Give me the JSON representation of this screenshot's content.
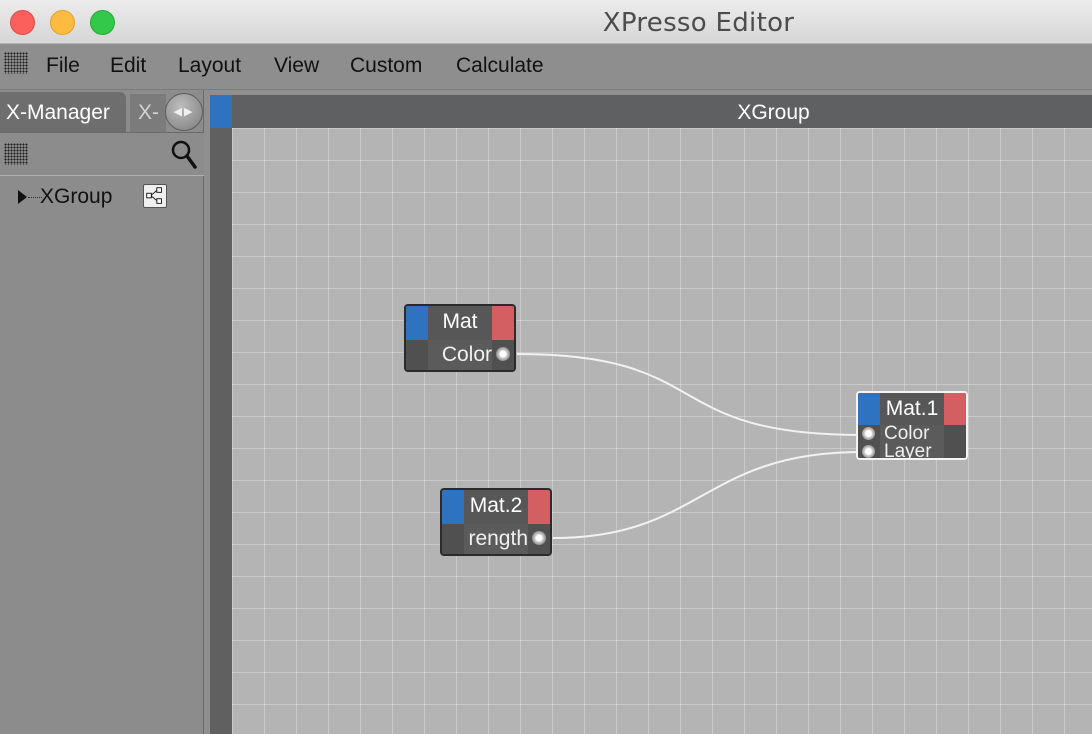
{
  "window": {
    "title": "XPresso Editor",
    "traffic_lights": [
      "close",
      "minimize",
      "zoom"
    ]
  },
  "menu": {
    "items": [
      "File",
      "Edit",
      "Layout",
      "View",
      "Custom",
      "Calculate"
    ]
  },
  "left_panel": {
    "active_tab": "X-Manager",
    "inactive_tab": "X-",
    "tree": [
      {
        "label": "XGroup",
        "icon": "xgroup-node-icon"
      }
    ]
  },
  "editor": {
    "title": "XGroup",
    "nodes": [
      {
        "id": "mat",
        "title": "Mat",
        "ports": [
          "Color"
        ]
      },
      {
        "id": "mat2",
        "title": "Mat.2",
        "ports": [
          "rength"
        ]
      },
      {
        "id": "mat1",
        "title": "Mat.1",
        "ports": [
          "Color",
          "Layer"
        ]
      }
    ],
    "connections": [
      {
        "from": "Mat.Color",
        "to": "Mat.1.Color"
      },
      {
        "from": "Mat.2.rength",
        "to": "Mat.1.Layer"
      }
    ]
  },
  "colors": {
    "node_input": "#2f72bf",
    "node_output": "#d35f62",
    "canvas": "#b4b4b4",
    "wire": "#f2f2f2"
  }
}
